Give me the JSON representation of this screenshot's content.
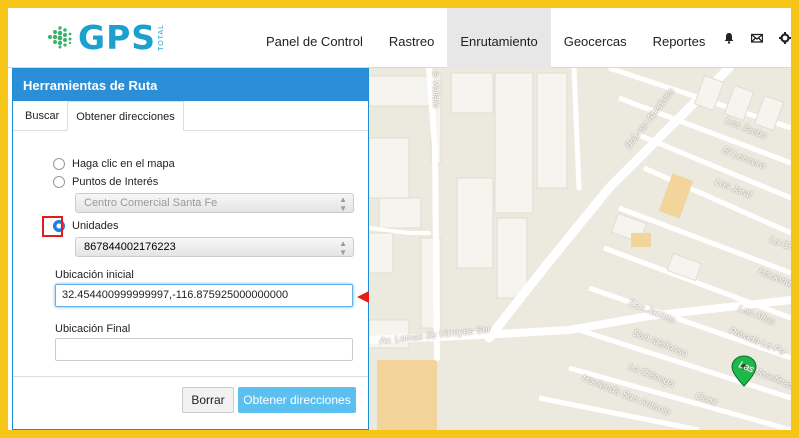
{
  "brand": {
    "logo_text": "GPS",
    "logo_subtext": "TOTAL",
    "accent": "#1ea0cf"
  },
  "nav": [
    {
      "label": "Panel de Control",
      "active": false
    },
    {
      "label": "Rastreo",
      "active": false
    },
    {
      "label": "Enrutamiento",
      "active": true
    },
    {
      "label": "Geocercas",
      "active": false
    },
    {
      "label": "Reportes",
      "active": false
    }
  ],
  "nav_icons": [
    "bell-icon",
    "envelope-icon",
    "gear-icon"
  ],
  "panel": {
    "title": "Herramientas de Ruta",
    "tabs": [
      {
        "label": "Buscar",
        "active": false
      },
      {
        "label": "Obtener direcciones",
        "active": true
      }
    ],
    "options": [
      {
        "label": "Haga clic en el mapa",
        "checked": false
      },
      {
        "label": "Puntos de Interés",
        "checked": false
      },
      {
        "label": "Unidades",
        "checked": true
      }
    ],
    "poi_select": "Centro Comercial Santa Fe",
    "unit_select": "867844002176223",
    "start_label": "Ubicación inicial",
    "start_value": "32.454400999999997,-116.875925000000000",
    "end_label": "Ubicación Final",
    "end_value": "",
    "clear_label": "Borrar",
    "submit_label": "Obtener direcciones"
  },
  "map": {
    "streets": [
      "a Vallalo",
      "Bulevar Abedules",
      "Los Jaebo",
      "El Lencero",
      "Los Jaral",
      "La Cr",
      "Hacienda",
      "Los Altos",
      "San Jacinto",
      "San Idelfonso",
      "Privada La Pu",
      "Av. Lomas de Virreyes Sur",
      "La Ciénega",
      "Las Josefinas",
      "Hacienda San Antonio",
      "Ochil"
    ],
    "marker_color": "#1db84a"
  }
}
